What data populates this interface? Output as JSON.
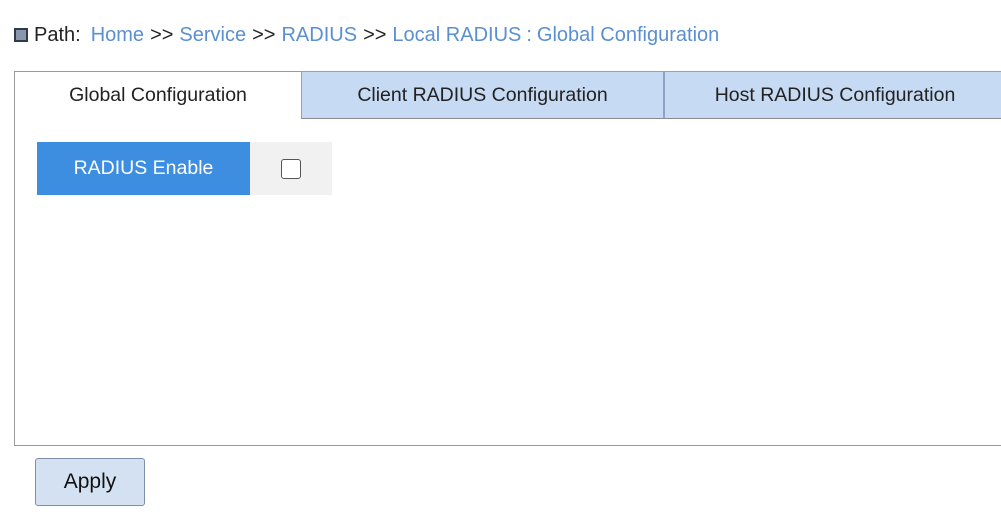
{
  "breadcrumb": {
    "label": "Path:",
    "items": [
      "Home",
      "Service",
      "RADIUS",
      "Local RADIUS",
      "Global Configuration"
    ],
    "separator": ">>",
    "final_separator": ":",
    "link_color": "#5a8fd1"
  },
  "tabs": [
    {
      "label": "Global Configuration",
      "active": true
    },
    {
      "label": "Client RADIUS Configuration",
      "active": false
    },
    {
      "label": "Host RADIUS Configuration",
      "active": false
    }
  ],
  "form": {
    "radius_enable": {
      "label": "RADIUS Enable",
      "checked": false,
      "label_color": "#3d8ee0"
    }
  },
  "actions": {
    "apply_label": "Apply"
  }
}
